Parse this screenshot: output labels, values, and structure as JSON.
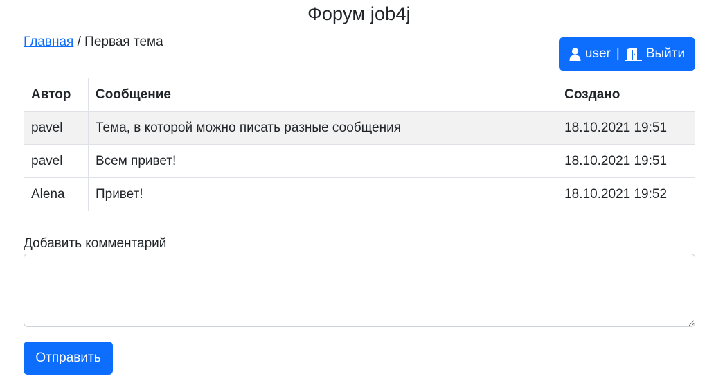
{
  "header": {
    "title": "Форум job4j"
  },
  "breadcrumb": {
    "home_label": "Главная",
    "separator": " / ",
    "current": "Первая тема"
  },
  "user_button": {
    "user_icon": "user-icon",
    "username": "user",
    "separator": "|",
    "logout_icon": "door-exit-icon",
    "logout_label": "Выйти",
    "color": "#0d6efd"
  },
  "table": {
    "headers": [
      "Автор",
      "Сообщение",
      "Создано"
    ],
    "rows": [
      {
        "author": "pavel",
        "message": "Тема, в которой можно писать разные сообщения",
        "created": "18.10.2021 19:51"
      },
      {
        "author": "pavel",
        "message": "Всем привет!",
        "created": "18.10.2021 19:51"
      },
      {
        "author": "Alena",
        "message": "Привет!",
        "created": "18.10.2021 19:52"
      }
    ]
  },
  "comment_form": {
    "label": "Добавить комментарий",
    "value": "",
    "submit_label": "Отправить"
  }
}
